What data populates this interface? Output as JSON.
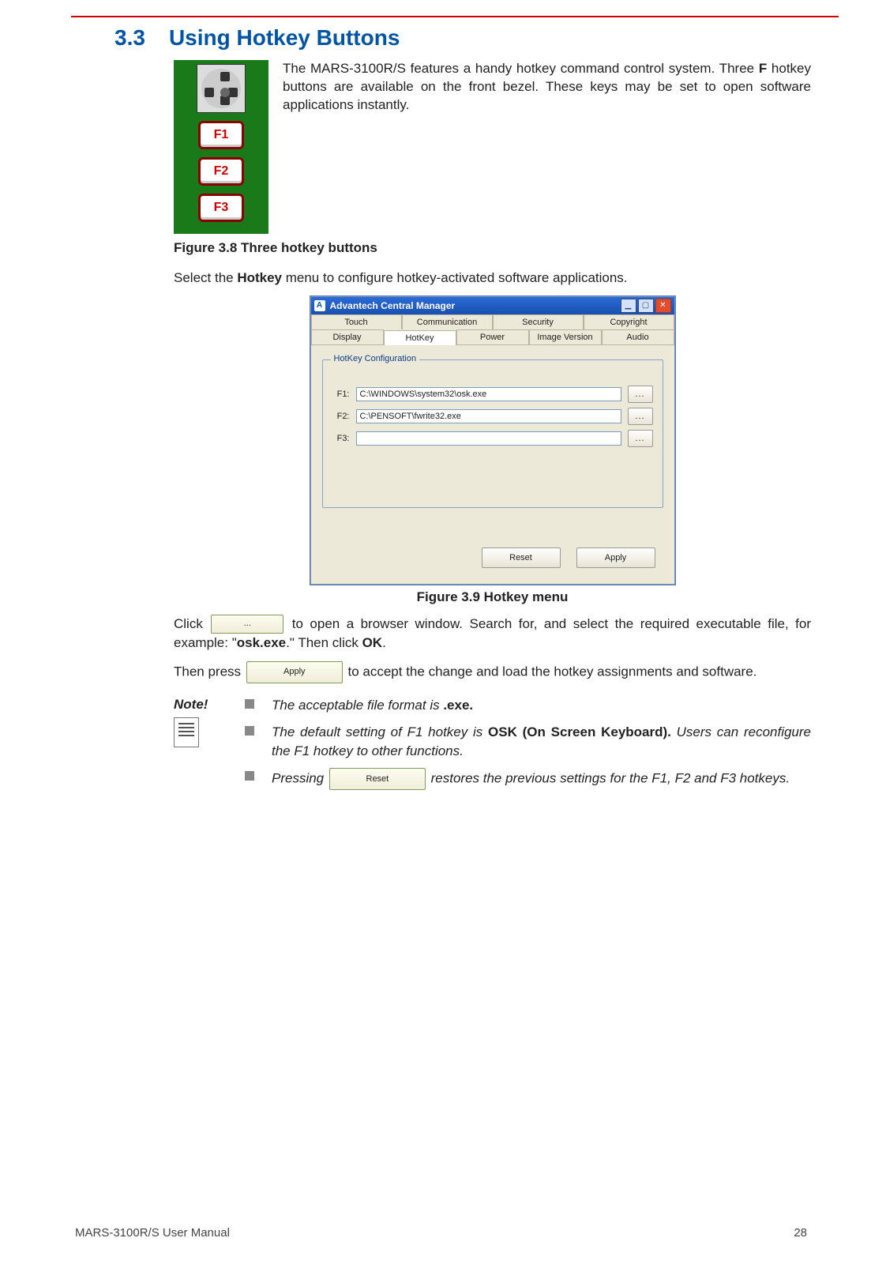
{
  "section": {
    "number": "3.3",
    "title": "Using Hotkey Buttons"
  },
  "intro": {
    "text": "The MARS-3100R/S features a handy hotkey command control system. Three ",
    "boldF": "F",
    "text2": " hotkey buttons are available on the front bezel. These keys may be set to open software applications instantly."
  },
  "fig38": {
    "f1": "F1",
    "f2": "F2",
    "f3": "F3",
    "caption": "Figure 3.8 Three hotkey buttons"
  },
  "para_select": {
    "pre": "Select the ",
    "bold": "Hotkey",
    "post": " menu to configure hotkey-activated software applications."
  },
  "win": {
    "title": "Advantech Central Manager",
    "app_icon_letter": "A",
    "min_glyph": "▁",
    "max_glyph": "▢",
    "close_glyph": "✕",
    "tabs_top": [
      "Touch",
      "Communication",
      "Security",
      "Copyright"
    ],
    "tabs_bot": [
      "Display",
      "HotKey",
      "Power",
      "Image Version",
      "Audio"
    ],
    "group_title": "HotKey Configuration",
    "rows": [
      {
        "label": "F1:",
        "value": "C:\\WINDOWS\\system32\\osk.exe"
      },
      {
        "label": "F2:",
        "value": "C:\\PENSOFT\\fwrite32.exe"
      },
      {
        "label": "F3:",
        "value": ""
      }
    ],
    "browse_label": "...",
    "reset_label": "Reset",
    "apply_label": "Apply",
    "caption": "Figure 3.9 Hotkey menu"
  },
  "para_click": {
    "pre": "Click ",
    "btn": "...",
    "post": " to open a browser window. Search for, and select the required executable file, for example: \"",
    "bold_file": "osk.exe",
    "post2": ".\" Then click ",
    "bold_ok": "OK",
    "post3": "."
  },
  "para_apply": {
    "pre": "Then press ",
    "btn": "Apply",
    "post": " to accept the change and load the hotkey assignments and software."
  },
  "note": {
    "label": "Note!",
    "items": [
      {
        "pre": "The acceptable file format is ",
        "bold": ".exe.",
        "post": ""
      },
      {
        "pre": "The default setting of F1 hotkey is ",
        "bold": "OSK (On Screen Keyboard).",
        "post": " Users can reconfigure the F1 hotkey to other functions."
      },
      {
        "pre": "Pressing ",
        "btn": "Reset",
        "post": " restores the previous settings for the F1, F2 and F3 hotkeys."
      }
    ]
  },
  "footer": {
    "left": "MARS-3100R/S User Manual",
    "page": "28"
  }
}
